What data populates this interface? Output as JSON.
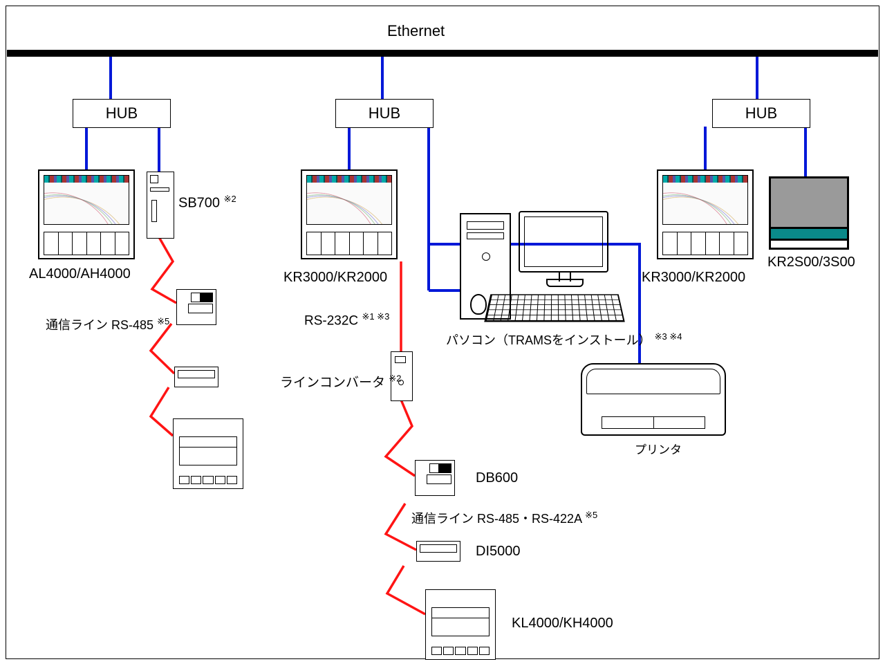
{
  "title_bar": "Ethernet",
  "hubs": {
    "h1": "HUB",
    "h2": "HUB",
    "h3": "HUB"
  },
  "devices": {
    "al4000": "AL4000/AH4000",
    "sb700": "SB700",
    "sb700_note": "※2",
    "rs485_line": "通信ライン RS-485",
    "rs485_note": "※5",
    "kr3000_left": "KR3000/KR2000",
    "rs232c": "RS-232C",
    "rs232c_note": "※1 ※3",
    "lineconv": "ラインコンバータ",
    "lineconv_note": "※2",
    "pc": "パソコン（TRAMSをインストール）",
    "pc_note": "※3 ※4",
    "printer": "プリンタ",
    "db600": "DB600",
    "rs485_422": "通信ライン RS-485・RS-422A",
    "rs485_422_note": "※5",
    "di5000": "DI5000",
    "kl4000": "KL4000/KH4000",
    "kr3000_right": "KR3000/KR2000",
    "kr2s": "KR2S00/3S00"
  },
  "colors": {
    "ethernet_line": "#0018d8",
    "serial_line": "#ff1414"
  }
}
